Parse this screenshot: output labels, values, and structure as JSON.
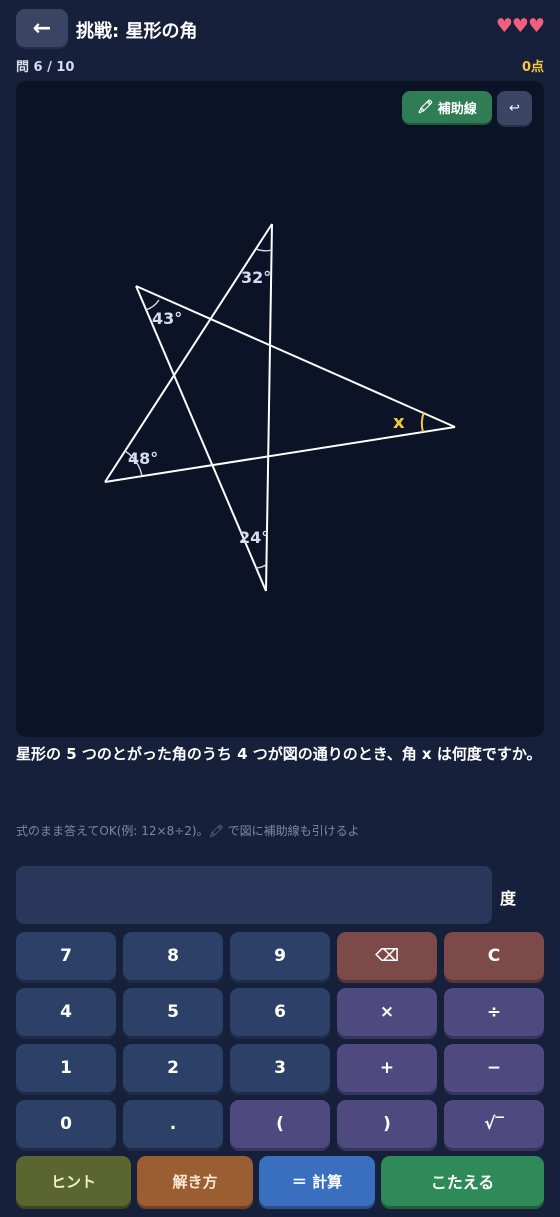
{
  "header": {
    "back_label": "←",
    "title": "挑戦: 星形の角",
    "hearts": "♥♥♥"
  },
  "status": {
    "progress": "問 6 / 10",
    "score": "0点"
  },
  "toolbar": {
    "aux_line_icon": "pencil-icon",
    "aux_line_label": "補助線",
    "undo_label": "↩"
  },
  "figure": {
    "angle_a": "32°",
    "angle_b": "43°",
    "angle_c": "48°",
    "angle_d": "24°",
    "unknown": "x"
  },
  "question": "星形の 5 つのとがった角のうち 4 つが図の通りのとき、角 x は何度ですか。",
  "hint": "式のまま答えてOK(例: 12×8÷2)。🖍 で図に補助線も引けるよ",
  "input": {
    "value": "",
    "unit": "度"
  },
  "keypad": {
    "rows": [
      [
        "7",
        "8",
        "9",
        "⌫",
        "C"
      ],
      [
        "4",
        "5",
        "6",
        "×",
        "÷"
      ],
      [
        "1",
        "2",
        "3",
        "+",
        "−"
      ],
      [
        "0",
        ".",
        "(",
        ")",
        "√‾"
      ]
    ]
  },
  "actions": {
    "hint": "ヒント",
    "solution": "解き方",
    "calculate": "＝ 計算",
    "submit": "こたえる"
  },
  "colors": {
    "background": "#17203a",
    "canvas": "#0d1326",
    "unknown_angle": "#f5c842",
    "angle_label": "#d8dcf0"
  }
}
